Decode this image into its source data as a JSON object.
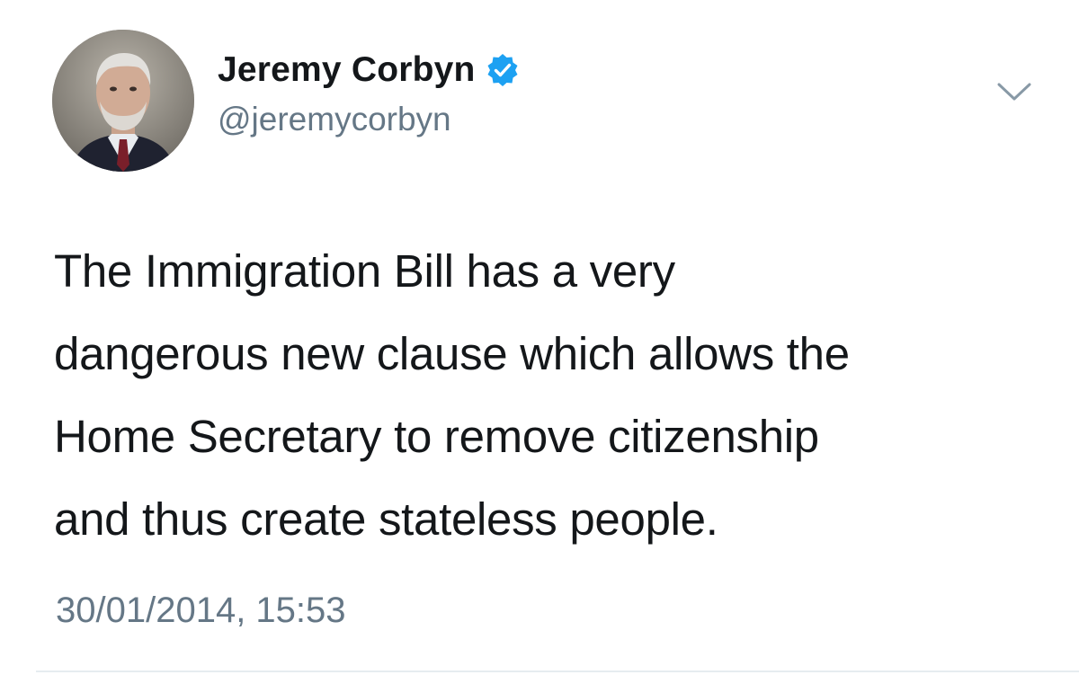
{
  "tweet": {
    "author": {
      "display_name": "Jeremy Corbyn",
      "handle": "@jeremycorbyn",
      "verified": true,
      "avatar_icon": "avatar-photo",
      "verified_icon": "verified-badge-icon"
    },
    "menu_icon": "chevron-down-icon",
    "text_lines": [
      "The Immigration Bill has a very",
      "dangerous new clause which allows the",
      "Home Secretary to remove citizenship",
      "and thus create stateless people."
    ],
    "timestamp": "30/01/2014, 15:53"
  },
  "colors": {
    "text_primary": "#14171a",
    "text_secondary": "#657786",
    "verified_blue": "#1da1f2",
    "divider": "#e6ecf0"
  }
}
